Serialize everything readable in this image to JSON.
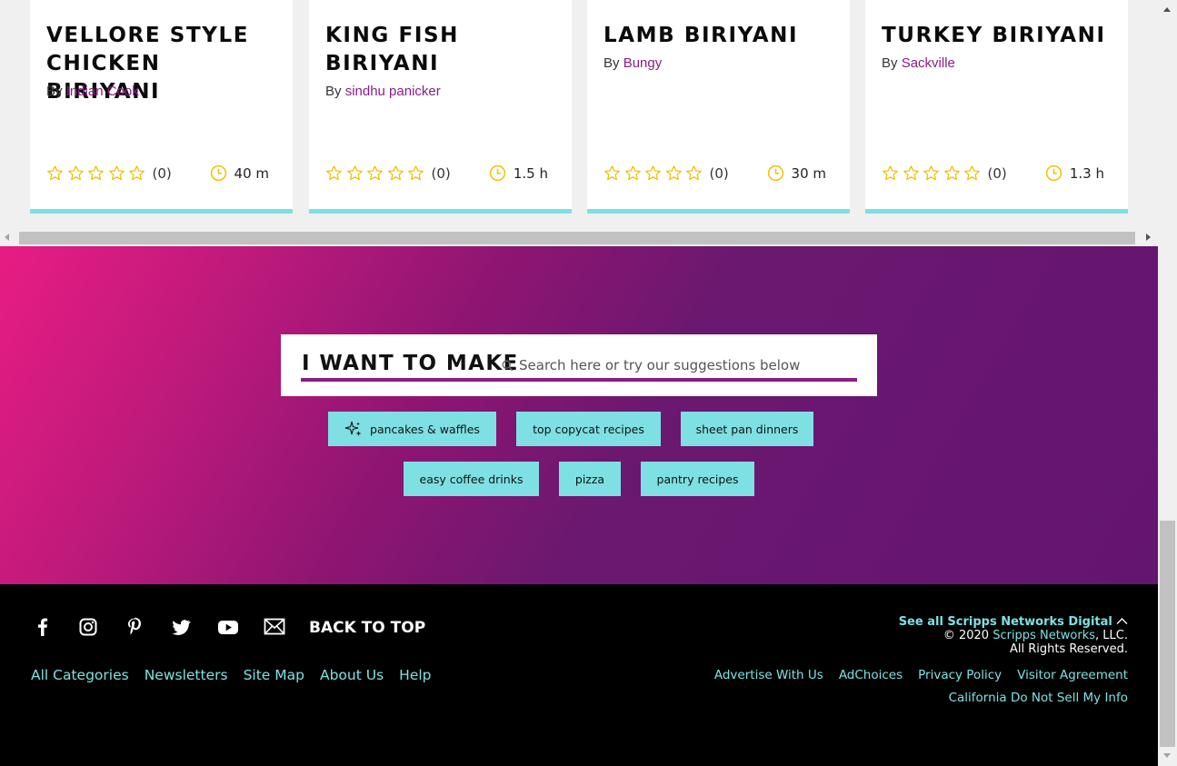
{
  "cards": [
    {
      "title": "VELLORE STYLE CHICKEN BIRIYANI",
      "by": "By",
      "author": "Indian Cook",
      "rating_count": "(0)",
      "time": "40 m",
      "stars": 0
    },
    {
      "title": "KING FISH BIRIYANI",
      "by": "By",
      "author": "sindhu panicker",
      "rating_count": "(0)",
      "time": "1.5 h",
      "stars": 0
    },
    {
      "title": "LAMB BIRIYANI",
      "by": "By",
      "author": "Bungy",
      "rating_count": "(0)",
      "time": "30 m",
      "stars": 0
    },
    {
      "title": "TURKEY BIRIYANI",
      "by": "By",
      "author": "Sackville",
      "rating_count": "(0)",
      "time": "1.3 h",
      "stars": 0
    }
  ],
  "search": {
    "heading": "I WANT TO MAKE",
    "placeholder": "Search here or try our suggestions below"
  },
  "suggestions": [
    {
      "label": "pancakes & waffles",
      "icon": "sparkle-icon"
    },
    {
      "label": "top copycat recipes"
    },
    {
      "label": "sheet pan dinners"
    },
    {
      "label": "easy coffee drinks"
    },
    {
      "label": "pizza"
    },
    {
      "label": "pantry recipes"
    }
  ],
  "footer": {
    "social_icons": [
      "facebook-icon",
      "instagram-icon",
      "pinterest-icon",
      "twitter-icon",
      "youtube-icon",
      "email-icon"
    ],
    "back_to_top": "BACK TO TOP",
    "links": [
      "All Categories",
      "Newsletters",
      "Site Map",
      "About Us",
      "Help"
    ],
    "see_all": "See all Scripps Networks Digital",
    "copyright_prefix": "© 2020 ",
    "copyright_company": "Scripps Networks",
    "copyright_suffix": ", LLC.",
    "rights": "All Rights Reserved.",
    "legal_links": [
      "Advertise With Us",
      "AdChoices",
      "Privacy Policy",
      "Visitor Agreement"
    ],
    "do_not_sell": "California Do Not Sell My Info"
  },
  "colors": {
    "accent_teal": "#7ee0e3",
    "author_purple": "#8b1c86",
    "star_gold": "#f2c100",
    "gradient_start": "#e81c83",
    "gradient_end": "#641570"
  }
}
